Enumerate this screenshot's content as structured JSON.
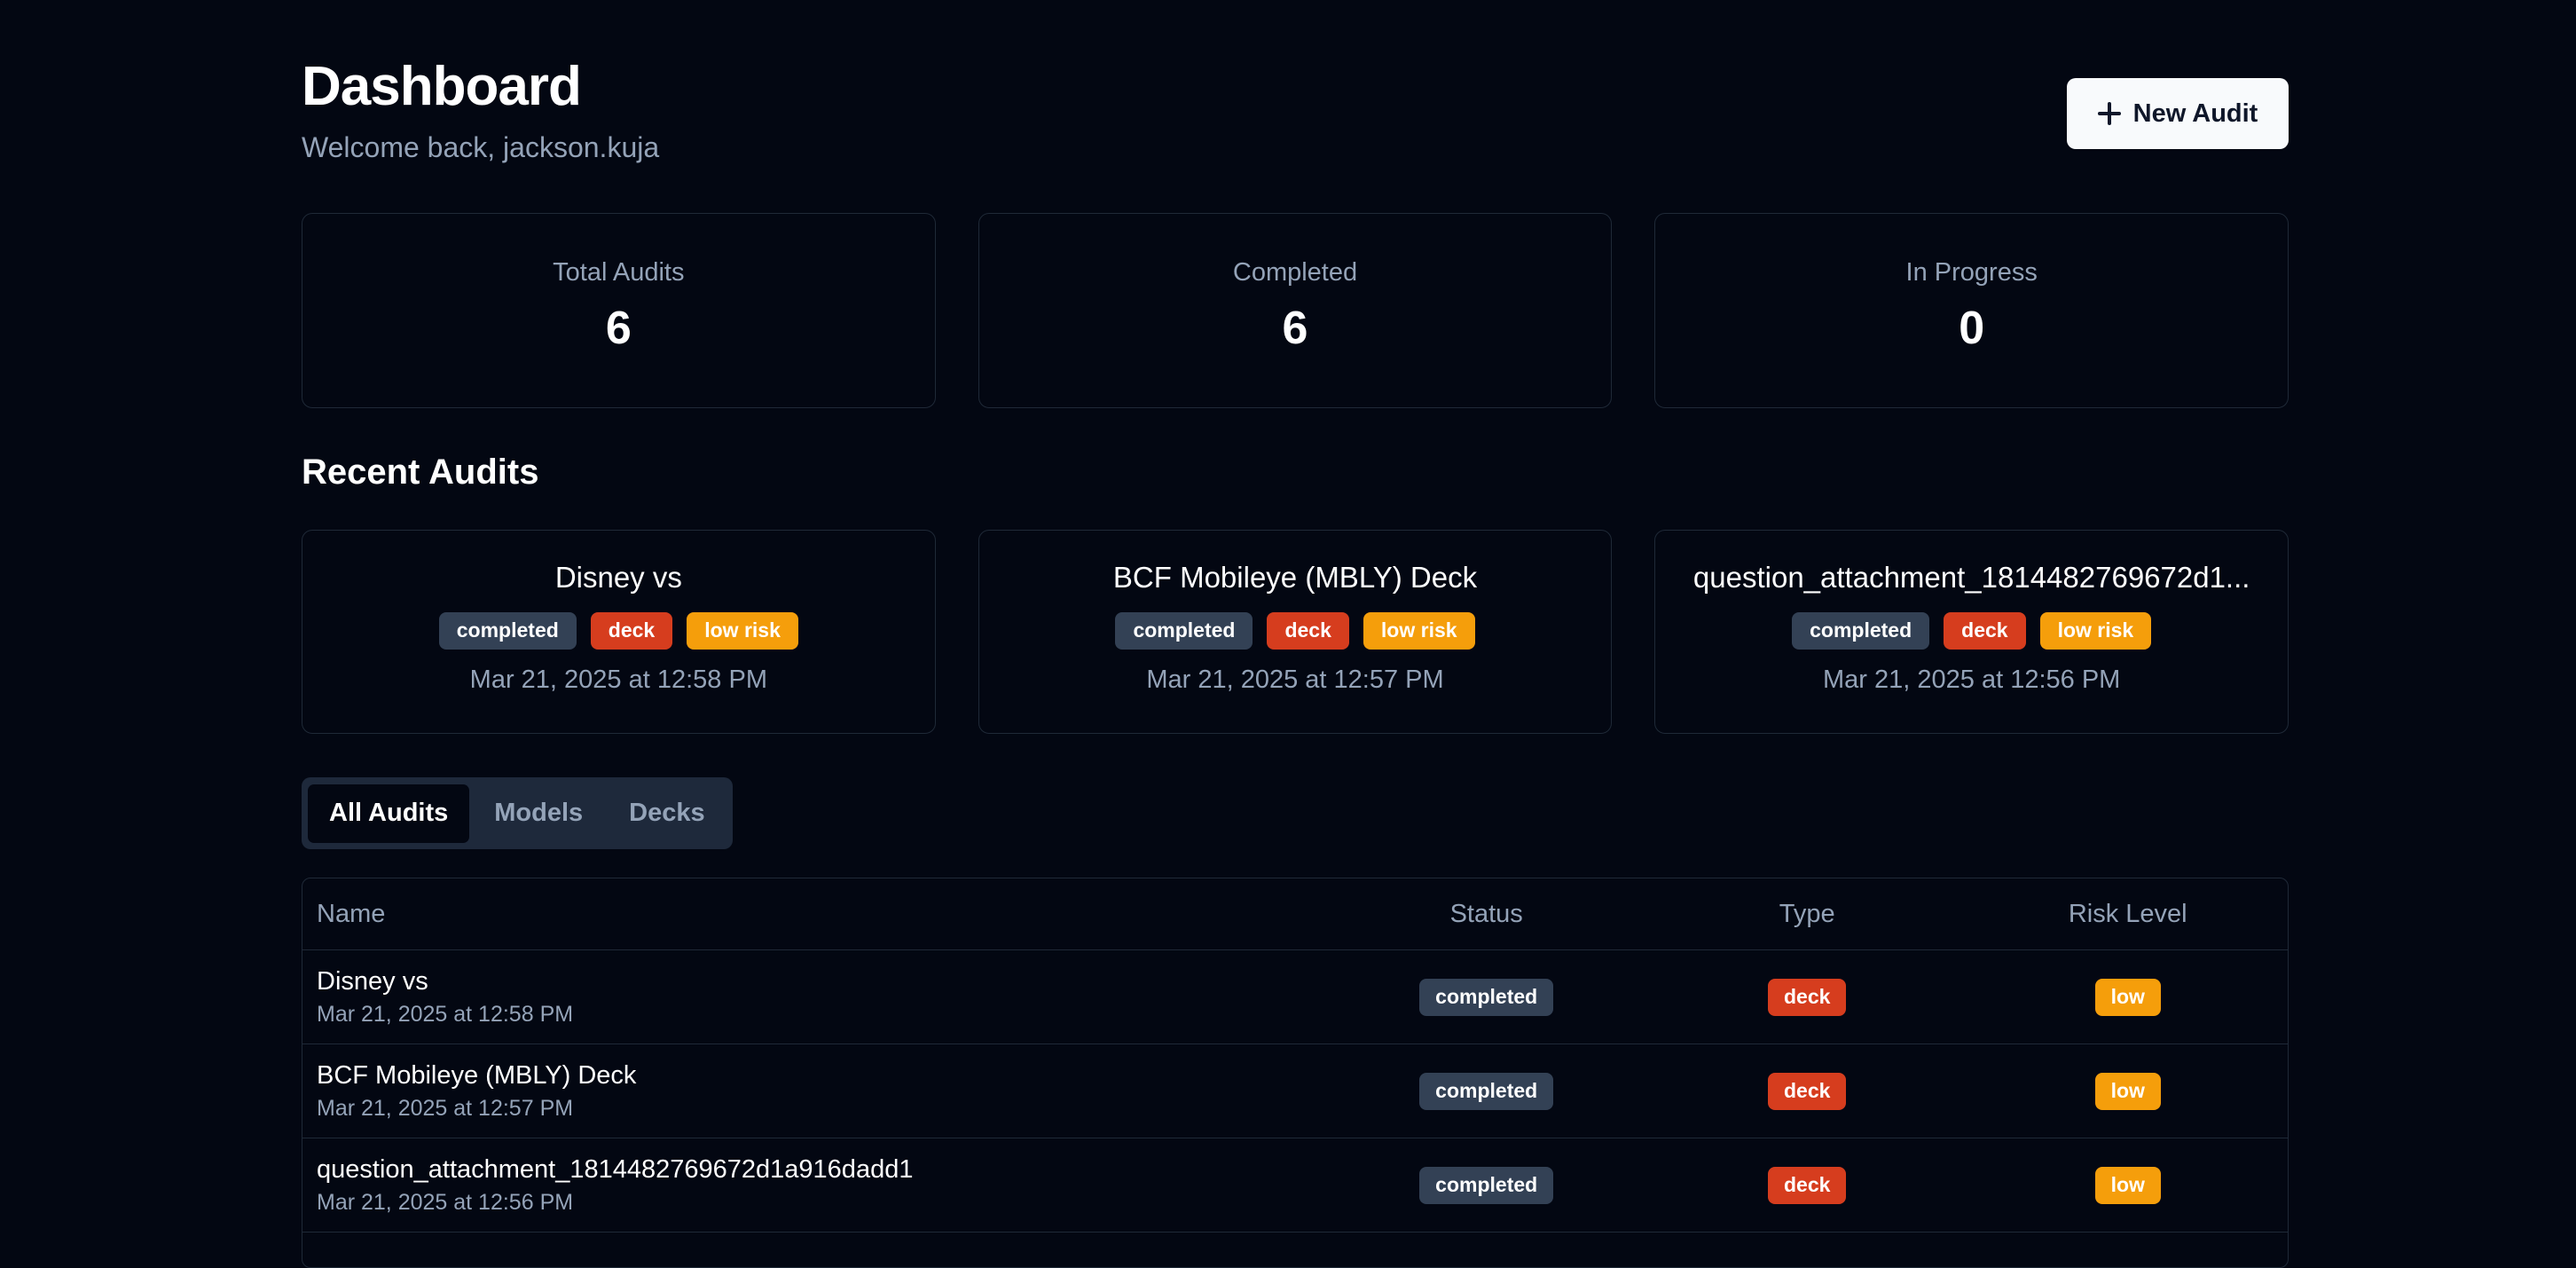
{
  "header": {
    "title": "Dashboard",
    "subtitle": "Welcome back, jackson.kuja",
    "new_audit_label": "New Audit"
  },
  "stats": [
    {
      "label": "Total Audits",
      "value": "6"
    },
    {
      "label": "Completed",
      "value": "6"
    },
    {
      "label": "In Progress",
      "value": "0"
    }
  ],
  "recent": {
    "title": "Recent Audits",
    "items": [
      {
        "name": "Disney vs",
        "status": "completed",
        "type": "deck",
        "risk": "low risk",
        "date": "Mar 21, 2025 at 12:58 PM"
      },
      {
        "name": "BCF Mobileye (MBLY) Deck",
        "status": "completed",
        "type": "deck",
        "risk": "low risk",
        "date": "Mar 21, 2025 at 12:57 PM"
      },
      {
        "name": "question_attachment_1814482769672d1...",
        "status": "completed",
        "type": "deck",
        "risk": "low risk",
        "date": "Mar 21, 2025 at 12:56 PM"
      }
    ]
  },
  "tabs": [
    {
      "label": "All Audits",
      "active": true
    },
    {
      "label": "Models",
      "active": false
    },
    {
      "label": "Decks",
      "active": false
    }
  ],
  "table": {
    "columns": [
      "Name",
      "Status",
      "Type",
      "Risk Level"
    ],
    "rows": [
      {
        "name": "Disney vs",
        "date": "Mar 21, 2025 at 12:58 PM",
        "status": "completed",
        "type": "deck",
        "risk": "low"
      },
      {
        "name": "BCF Mobileye (MBLY) Deck",
        "date": "Mar 21, 2025 at 12:57 PM",
        "status": "completed",
        "type": "deck",
        "risk": "low"
      },
      {
        "name": "question_attachment_1814482769672d1a916dadd1",
        "date": "Mar 21, 2025 at 12:56 PM",
        "status": "completed",
        "type": "deck",
        "risk": "low"
      }
    ]
  },
  "colors": {
    "background": "#030712",
    "status_completed": "#334155",
    "type_deck": "#d63d1e",
    "risk_low": "#f59e0b"
  },
  "icons": {
    "new_audit": "plus-icon"
  }
}
